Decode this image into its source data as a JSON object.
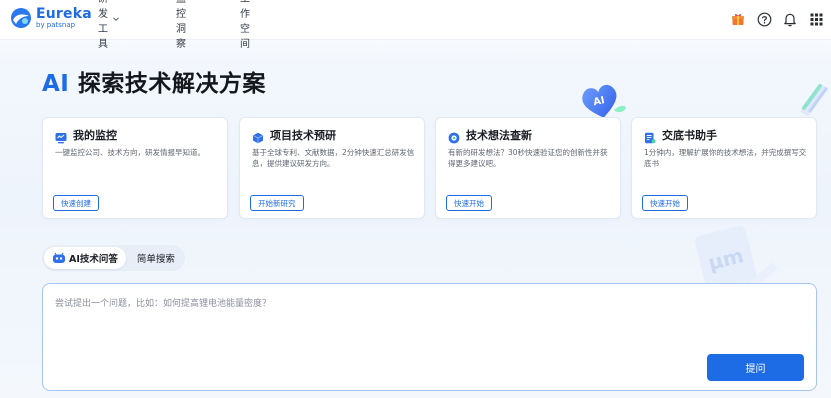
{
  "brand": {
    "name": "Eureka",
    "sub": "by patsnap",
    "color": "#1e6be6"
  },
  "nav": {
    "items": [
      {
        "label": "研发工具",
        "has_dropdown": true
      },
      {
        "label": "监控洞察"
      },
      {
        "label": "工作空间"
      }
    ]
  },
  "header_icons": [
    "gift-icon",
    "help-icon",
    "bell-icon",
    "apps-grid-icon"
  ],
  "hero": {
    "title_accent": "AI",
    "title_rest": "探索技术解决方案"
  },
  "cards": [
    {
      "title": "我的监控",
      "desc": "一键监控公司、技术方向，研发情报早知道。",
      "button": "快速创建",
      "icon": "monitor-icon"
    },
    {
      "title": "项目技术预研",
      "desc": "基于全球专利、文献数据，2分钟快速汇总研发信息，提供建议研发方向。",
      "button": "开始新研究",
      "icon": "research-cube-icon"
    },
    {
      "title": "技术想法查新",
      "desc": "有新的研发想法？30秒快速验证您的创新性并获得更多建议吧。",
      "button": "快速开始",
      "icon": "idea-check-icon"
    },
    {
      "title": "交底书助手",
      "desc": "1分钟内，理解扩展你的技术想法，并完成撰写交底书",
      "button": "快速开始",
      "icon": "document-assist-icon"
    }
  ],
  "tabs": {
    "items": [
      {
        "label": "AI技术问答",
        "active": true
      },
      {
        "label": "简单搜索",
        "active": false
      }
    ]
  },
  "question": {
    "placeholder": "尝试提出一个问题，比如：如何提高锂电池能量密度？",
    "value": "",
    "submit_label": "提问"
  },
  "decorations": {
    "badge_text": "AI",
    "um_text": "μm"
  },
  "colors": {
    "accent": "#1e6be6",
    "border": "#a8c4f5"
  }
}
